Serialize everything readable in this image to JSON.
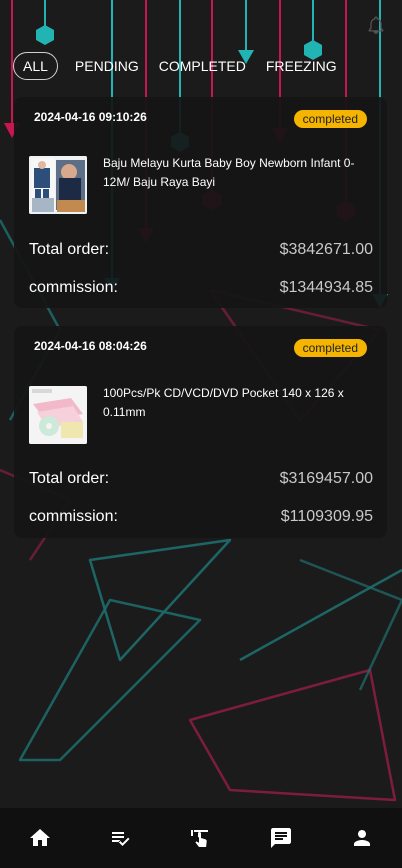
{
  "colors": {
    "accent_teal": "#22b3b3",
    "accent_pink": "#c8174e",
    "badge": "#f5b400",
    "background": "#1b1b1b"
  },
  "header": {
    "bell_icon": "bell-icon"
  },
  "tabs": [
    {
      "label": "ALL",
      "active": true
    },
    {
      "label": "PENDING",
      "active": false
    },
    {
      "label": "COMPLETED",
      "active": false
    },
    {
      "label": "FREEZING",
      "active": false
    }
  ],
  "orders": [
    {
      "datetime": "2024-04-16 09:10:26",
      "status": "completed",
      "product_name": "Baju Melayu Kurta Baby Boy Newborn Infant 0-12M/ Baju Raya Bayi",
      "total_label": "Total order:",
      "total_value": "$3842671.00",
      "commission_label": "commission:",
      "commission_value": "$1344934.85"
    },
    {
      "datetime": "2024-04-16 08:04:26",
      "status": "completed",
      "product_name": "100Pcs/Pk CD/VCD/DVD Pocket 140 x 126 x 0.11mm",
      "total_label": "Total order:",
      "total_value": "$3169457.00",
      "commission_label": "commission:",
      "commission_value": "$1109309.95"
    }
  ],
  "nav": [
    {
      "icon": "home-icon"
    },
    {
      "icon": "order-list-icon"
    },
    {
      "icon": "tap-icon"
    },
    {
      "icon": "message-icon"
    },
    {
      "icon": "profile-icon"
    }
  ]
}
